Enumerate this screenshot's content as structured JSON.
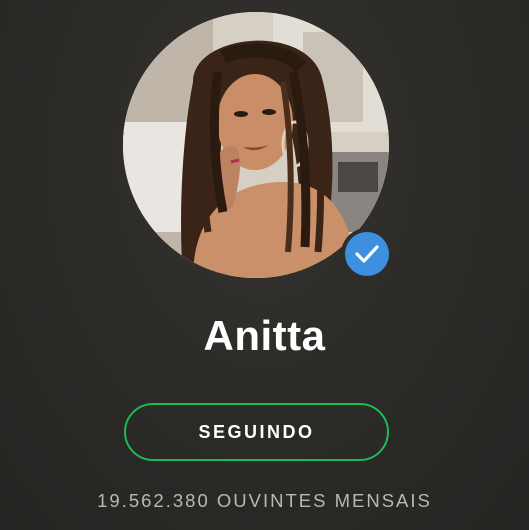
{
  "artist": {
    "name": "Anitta",
    "verified_icon": "verified-check-icon",
    "avatar_icon": "artist-photo"
  },
  "follow": {
    "label": "SEGUINDO"
  },
  "listeners": {
    "text": "19.562.380 OUVINTES MENSAIS"
  },
  "colors": {
    "background": "#2a2927",
    "accent_green": "#1db954",
    "verified_blue": "#3d8fe0",
    "text_primary": "#ffffff",
    "text_secondary": "#b9b7b2"
  }
}
